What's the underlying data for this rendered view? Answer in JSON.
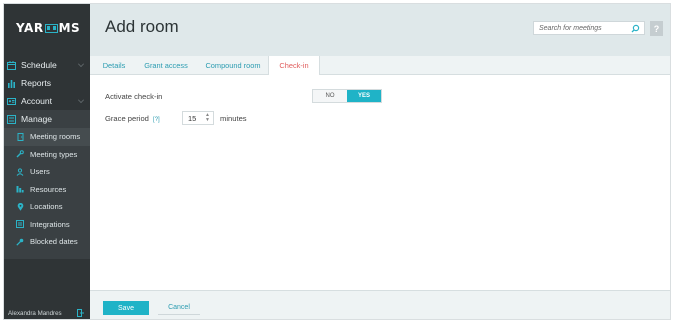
{
  "app": {
    "logo_text": "YAROOMS",
    "logo_pre": "YAR",
    "logo_post": "MS"
  },
  "sidebar": {
    "top_items": [
      {
        "label": "Schedule",
        "icon": "calendar-icon",
        "has_chevron": true
      },
      {
        "label": "Reports",
        "icon": "bar-chart-icon",
        "has_chevron": false
      },
      {
        "label": "Account",
        "icon": "account-icon",
        "has_chevron": true
      },
      {
        "label": "Manage",
        "icon": "manage-icon",
        "has_chevron": false
      }
    ],
    "manage_items": [
      {
        "label": "Meeting rooms",
        "icon": "door-icon",
        "active": true
      },
      {
        "label": "Meeting types",
        "icon": "wrench-icon",
        "active": false
      },
      {
        "label": "Users",
        "icon": "user-icon",
        "active": false
      },
      {
        "label": "Resources",
        "icon": "resources-icon",
        "active": false
      },
      {
        "label": "Locations",
        "icon": "location-pin-icon",
        "active": false
      },
      {
        "label": "Integrations",
        "icon": "integrations-icon",
        "active": false
      },
      {
        "label": "Blocked dates",
        "icon": "key-icon",
        "active": false
      }
    ],
    "user_name": "Alexandra Mandres"
  },
  "header": {
    "title": "Add room",
    "search_placeholder": "Search for meetings",
    "help_label": "?"
  },
  "tabs": [
    {
      "label": "Details",
      "active": false
    },
    {
      "label": "Grant access",
      "active": false
    },
    {
      "label": "Compound room",
      "active": false
    },
    {
      "label": "Check-in",
      "active": true
    }
  ],
  "form": {
    "activate_label": "Activate check-in",
    "toggle_no": "NO",
    "toggle_yes": "YES",
    "toggle_selected": "YES",
    "grace_label": "Grace period",
    "grace_help": "[?]",
    "grace_value": "15",
    "grace_unit": "minutes"
  },
  "footer": {
    "save_label": "Save",
    "cancel_label": "Cancel"
  },
  "colors": {
    "accent": "#1fb3c7",
    "sidebar_bg": "#2f3436",
    "active_tab": "#e05c5c",
    "header_bg": "#dfe8ea"
  }
}
